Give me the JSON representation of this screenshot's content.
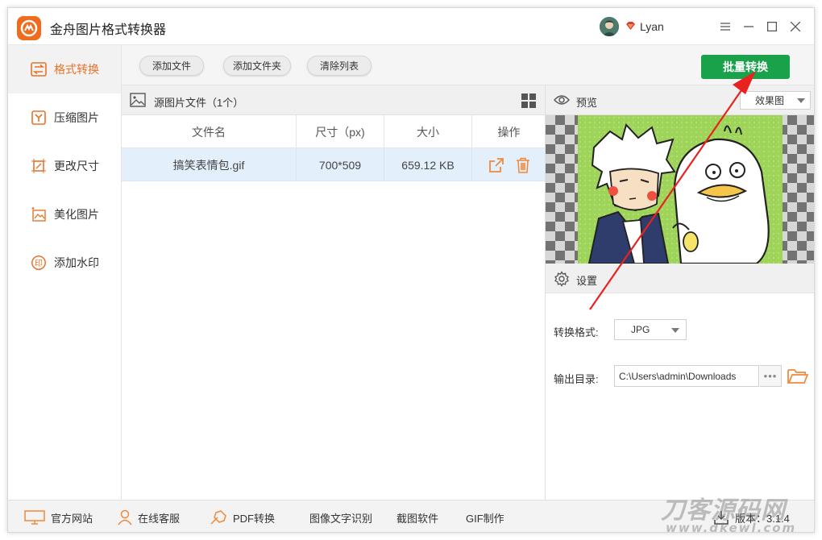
{
  "app": {
    "title": "金舟图片格式转换器",
    "user_name": "Lyan",
    "accent_color": "#e8732a",
    "primary_color": "#1aa24a"
  },
  "sidebar": {
    "items": [
      {
        "label": "格式转换",
        "icon": "format-convert-icon",
        "active": true
      },
      {
        "label": "压缩图片",
        "icon": "compress-icon",
        "active": false
      },
      {
        "label": "更改尺寸",
        "icon": "resize-icon",
        "active": false
      },
      {
        "label": "美化图片",
        "icon": "beautify-icon",
        "active": false
      },
      {
        "label": "添加水印",
        "icon": "watermark-icon",
        "active": false
      }
    ]
  },
  "toolbar": {
    "add_file": "添加文件",
    "add_folder": "添加文件夹",
    "clear_list": "清除列表",
    "batch_convert": "批量转换"
  },
  "file_panel": {
    "title": "源图片文件（1个）",
    "columns": [
      "文件名",
      "尺寸（px)",
      "大小",
      "操作"
    ],
    "rows": [
      {
        "name": "搞笑表情包.gif",
        "dimensions": "700*509",
        "size": "659.12 KB"
      }
    ]
  },
  "preview": {
    "label": "预览",
    "mode": "效果图"
  },
  "settings": {
    "label": "设置",
    "format_label": "转换格式:",
    "format_value": "JPG",
    "output_label": "输出目录:",
    "output_value": "C:\\Users\\admin\\Downloads",
    "more_label": "•••"
  },
  "statusbar": {
    "website": "官方网站",
    "support": "在线客服",
    "pdf": "PDF转换",
    "ocr": "图像文字识别",
    "screenshot": "截图软件",
    "gif": "GIF制作",
    "version": "版本：3.1.4"
  },
  "watermark": {
    "line1": "刀客源码网",
    "line2": "www.dkewl.com"
  }
}
